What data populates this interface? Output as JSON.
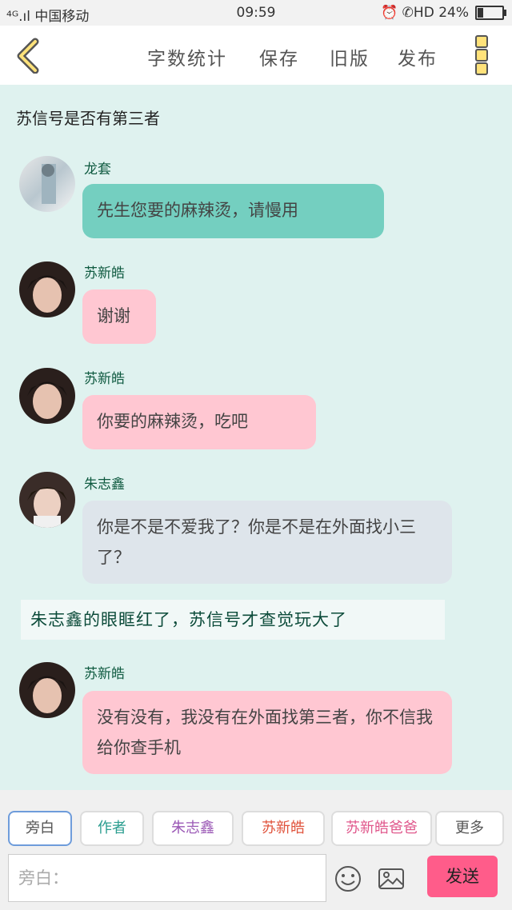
{
  "status_bar": {
    "left": "⁴ᴳ.ıl 中国移动 ",
    "time": "09:59",
    "right": "⏰ ✆HD 24%"
  },
  "toolbar": {
    "items": [
      "字数统计",
      "保存",
      "旧版",
      "发布"
    ]
  },
  "chat": {
    "title": "苏信号是否有第三者",
    "messages": [
      {
        "name": "龙套",
        "text": "先生您要的麻辣烫，请慢用"
      },
      {
        "name": "苏新皓",
        "text": "谢谢"
      },
      {
        "name": "苏新皓",
        "text": "你要的麻辣烫，吃吧"
      },
      {
        "name": "朱志鑫",
        "text": "你是不是不爱我了？你是不是在外面找小三了？"
      },
      {
        "name": "苏新皓",
        "text": "没有没有，我没有在外面找第三者，你不信我给你查手机"
      }
    ],
    "narration": "朱志鑫的眼眶红了，苏信号才查觉玩大了"
  },
  "bottom": {
    "roles": [
      "旁白",
      "作者",
      "朱志鑫",
      "苏新皓",
      "苏新皓爸爸",
      "更多"
    ],
    "role_colors": [
      "#555555",
      "#2a9d8f",
      "#9b59b6",
      "#e0533c",
      "#e0588c",
      "#555555"
    ],
    "input_placeholder": "旁白：",
    "send_label": "发送"
  },
  "colors": {
    "background": "#dff2ef",
    "green_bubble": "#74cfc0",
    "pink_bubble": "#ffc7d2",
    "grey_bubble": "#dee5eb",
    "send_button": "#ff5c8a"
  }
}
